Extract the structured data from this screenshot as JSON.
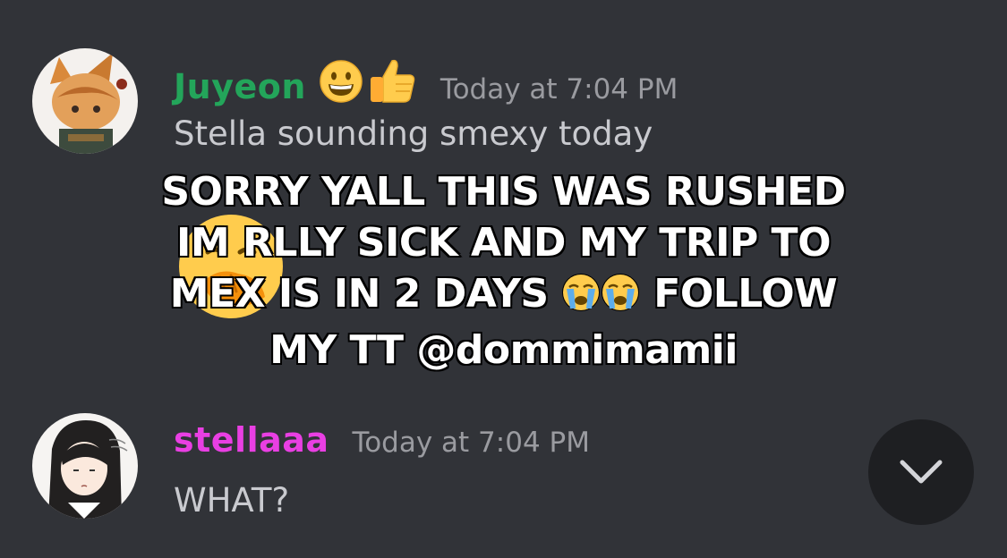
{
  "messages": [
    {
      "username": "Juyeon",
      "username_color": "#23a55a",
      "badge_icons": [
        "grinning-face-icon",
        "thumbs-up-icon"
      ],
      "timestamp": "Today at 7:04 PM",
      "text": "Stella sounding smexy today",
      "avatar_icon": "anime-fox-character-avatar"
    },
    {
      "username": "stellaaa",
      "username_color": "#e93fe3",
      "timestamp": "Today at 7:04 PM",
      "text": "WHAT?",
      "avatar_icon": "anime-girl-avatar"
    }
  ],
  "overlay_caption": {
    "line1": "SORRY YALL THIS WAS RUSHED",
    "line2": "IM RLLY SICK AND MY TRIP TO",
    "line3_a": "MEX IS IN 2 DAYS",
    "line3_b": "FOLLOW",
    "line4": "MY TT @dommimamii",
    "emoji_icons": [
      "loudly-crying-face-icon",
      "loudly-crying-face-icon"
    ]
  },
  "reaction_emoji_icon": "face-with-hand-over-mouth-icon",
  "scroll_button_icon": "chevron-down-icon",
  "colors": {
    "background": "#313338",
    "timestamp": "#9a9ba0",
    "message_text": "#c9cacf"
  }
}
